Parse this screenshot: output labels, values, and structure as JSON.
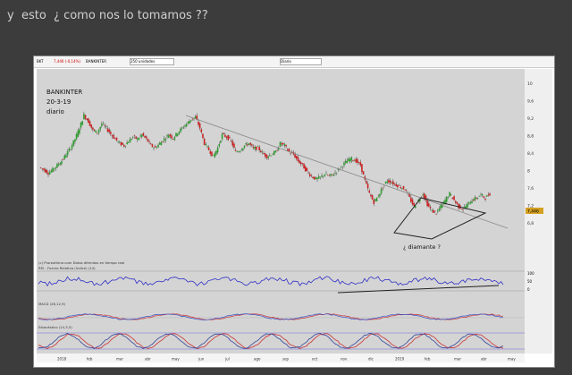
{
  "caption": "y  esto  ¿ como nos lo tomamos ??",
  "toolbar": {
    "symbol": "BKT",
    "quote": "7,446 (-0,14%)",
    "name": "BANKINTER",
    "units_select": "250 unidades",
    "period_select": "Diario"
  },
  "chart": {
    "title_lines": [
      "BANKINTER",
      "20-3-19",
      "diario"
    ],
    "annotation": "¿ diamante ?",
    "price_scale": [
      "10",
      "9,6",
      "9,2",
      "8,8",
      "8,4",
      "8",
      "7,6",
      "7,2",
      "6,8"
    ],
    "current_price": "7,446",
    "rsi_label": "(c) Prorealtime.com Datos diferidos en tiempo real",
    "rsi_sublabel": "RSI - Fuerza Relativa (índice) (14)",
    "rsi_scale": [
      "100",
      "50",
      "0"
    ],
    "macd_label": "MACD (26,12,9)",
    "stoch_label": "Estocástico (14,3,5)",
    "x_axis": [
      "2018",
      "feb",
      "mar",
      "abr",
      "may",
      "jun",
      "jul",
      "ago",
      "sep",
      "oct",
      "nov",
      "dic",
      "2019",
      "feb",
      "mar",
      "abr",
      "may"
    ],
    "price_series": [
      8.05,
      8.0,
      7.92,
      8.0,
      8.1,
      8.2,
      8.35,
      8.5,
      8.7,
      8.95,
      9.25,
      9.1,
      8.9,
      8.85,
      9.05,
      8.95,
      8.82,
      8.7,
      8.6,
      8.55,
      8.65,
      8.75,
      8.7,
      8.8,
      8.7,
      8.55,
      8.5,
      8.6,
      8.7,
      8.8,
      8.72,
      8.85,
      8.95,
      9.05,
      9.15,
      9.2,
      8.95,
      8.6,
      8.45,
      8.3,
      8.5,
      8.8,
      8.75,
      8.65,
      8.4,
      8.45,
      8.55,
      8.6,
      8.48,
      8.5,
      8.38,
      8.3,
      8.35,
      8.4,
      8.6,
      8.55,
      8.4,
      8.35,
      8.2,
      8.1,
      7.95,
      7.85,
      7.78,
      7.82,
      7.9,
      7.85,
      7.9,
      8.0,
      8.1,
      8.2,
      8.25,
      8.2,
      8.1,
      7.75,
      7.45,
      7.25,
      7.4,
      7.6,
      7.75,
      7.7,
      7.65,
      7.6,
      7.55,
      7.35,
      7.15,
      7.3,
      7.45,
      7.2,
      7.05,
      7.0,
      7.15,
      7.3,
      7.45,
      7.3,
      7.15,
      7.1,
      7.2,
      7.3,
      7.35,
      7.42,
      7.35,
      7.45
    ]
  }
}
